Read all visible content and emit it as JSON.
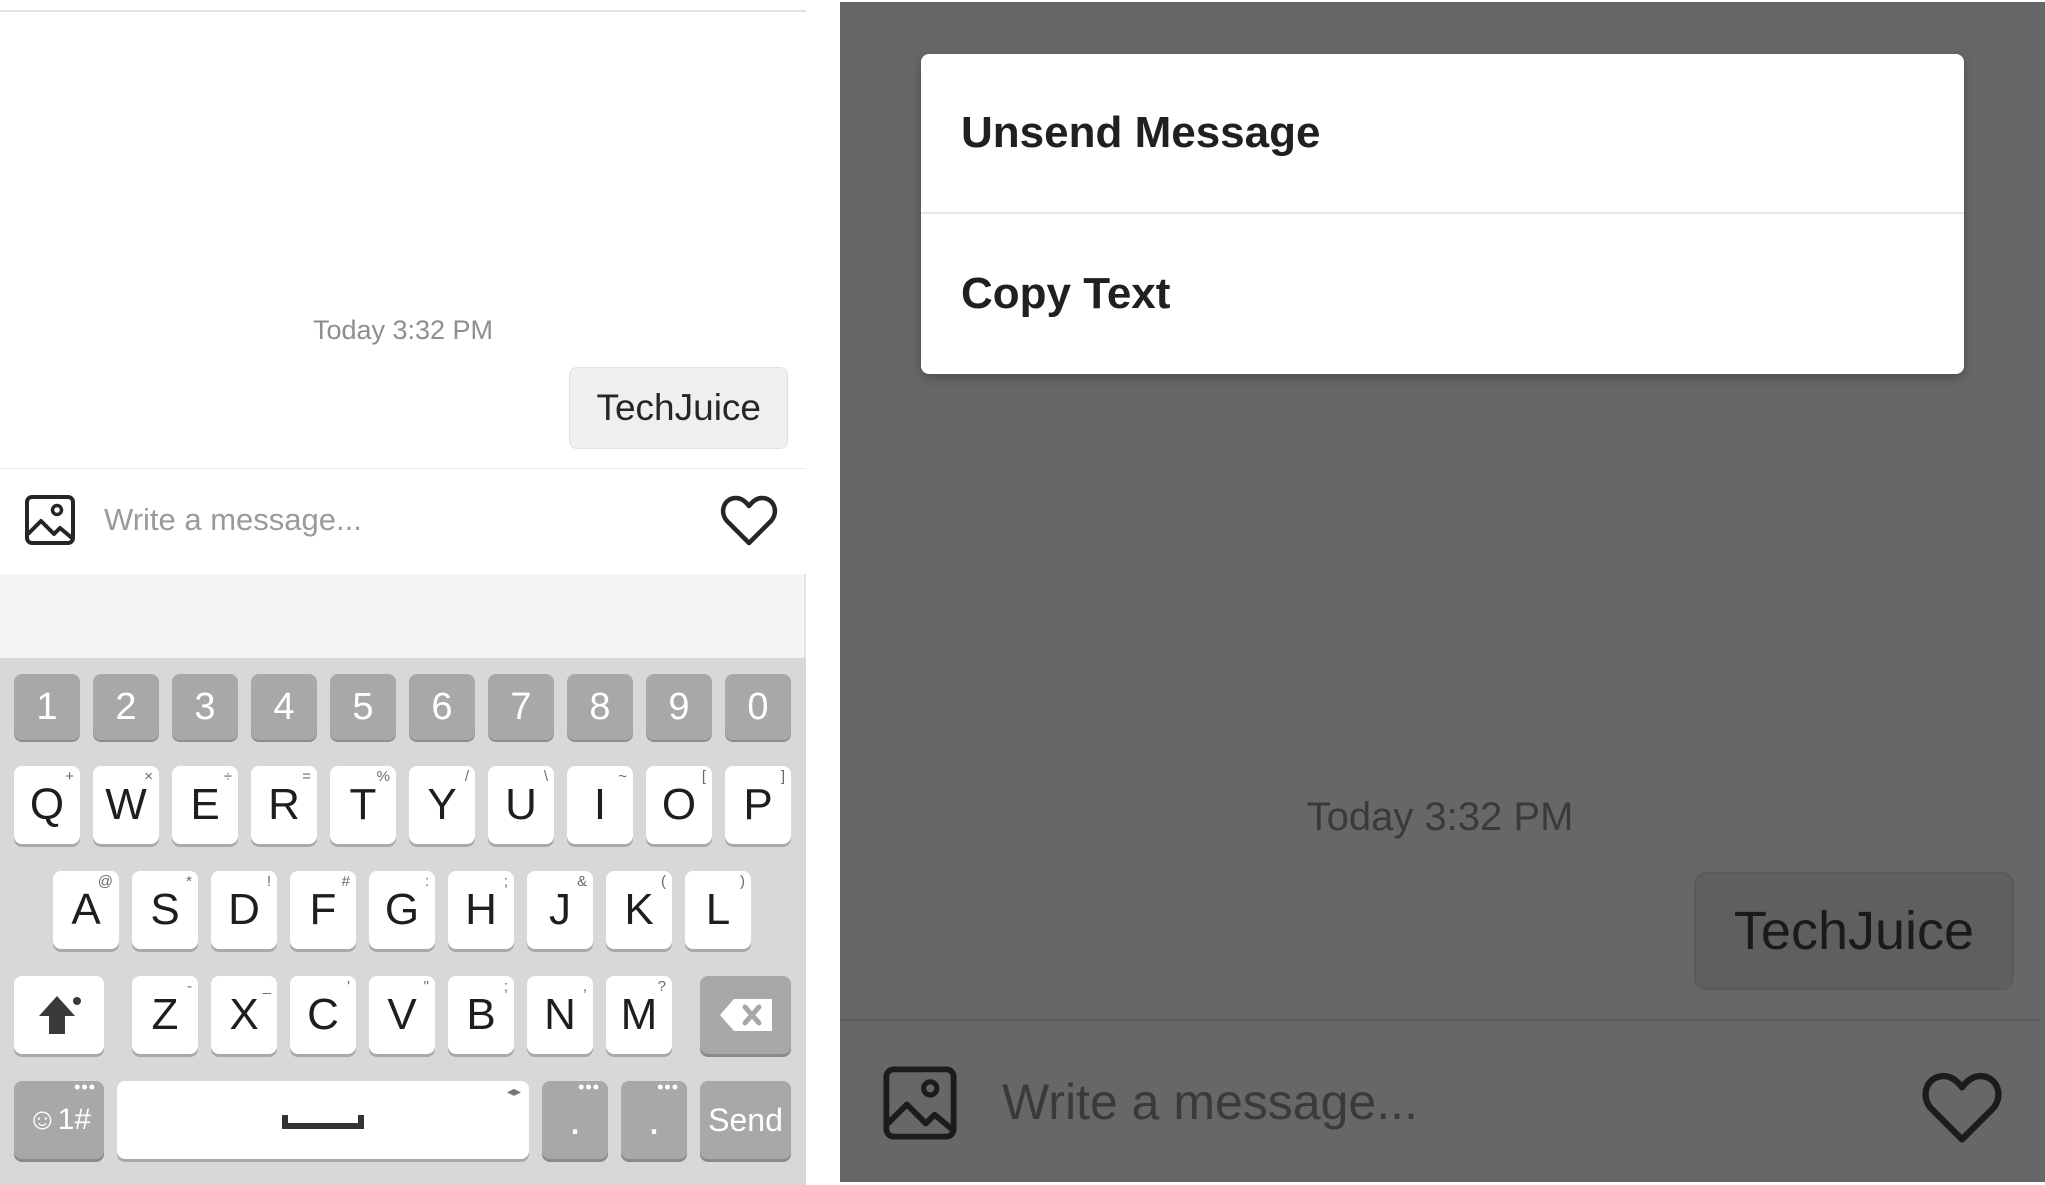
{
  "left_screen": {
    "timestamp": "Today 3:32 PM",
    "message_bubble": "TechJuice",
    "composer": {
      "placeholder": "Write a message...",
      "image_icon": "image-icon",
      "like_icon": "heart-icon"
    },
    "keyboard": {
      "number_row": [
        "1",
        "2",
        "3",
        "4",
        "5",
        "6",
        "7",
        "8",
        "9",
        "0"
      ],
      "row1": [
        {
          "label": "Q",
          "sub": "+"
        },
        {
          "label": "W",
          "sub": "×"
        },
        {
          "label": "E",
          "sub": "÷"
        },
        {
          "label": "R",
          "sub": "="
        },
        {
          "label": "T",
          "sub": "%"
        },
        {
          "label": "Y",
          "sub": "/"
        },
        {
          "label": "U",
          "sub": "\\"
        },
        {
          "label": "I",
          "sub": "~"
        },
        {
          "label": "O",
          "sub": "["
        },
        {
          "label": "P",
          "sub": "]"
        }
      ],
      "row2": [
        {
          "label": "A",
          "sub": "@"
        },
        {
          "label": "S",
          "sub": "*"
        },
        {
          "label": "D",
          "sub": "!"
        },
        {
          "label": "F",
          "sub": "#"
        },
        {
          "label": "G",
          "sub": ":"
        },
        {
          "label": "H",
          "sub": ";"
        },
        {
          "label": "J",
          "sub": "&"
        },
        {
          "label": "K",
          "sub": "("
        },
        {
          "label": "L",
          "sub": ")"
        }
      ],
      "row3": [
        {
          "label": "Z",
          "sub": "-"
        },
        {
          "label": "X",
          "sub": "_"
        },
        {
          "label": "C",
          "sub": "'"
        },
        {
          "label": "V",
          "sub": "\""
        },
        {
          "label": "B",
          "sub": ";"
        },
        {
          "label": "N",
          "sub": ","
        },
        {
          "label": "M",
          "sub": "?"
        }
      ],
      "shift_icon": "shift-arrow-icon",
      "backspace_icon": "backspace-icon",
      "symbols_label": "☺1#",
      "period_label_1": ".",
      "period_label_2": ".",
      "send_label": "Send"
    }
  },
  "right_screen": {
    "menu": {
      "items": [
        "Unsend Message",
        "Copy Text"
      ]
    },
    "timestamp": "Today 3:32 PM",
    "message_bubble": "TechJuice",
    "composer": {
      "placeholder": "Write a message...",
      "image_icon": "image-icon",
      "like_icon": "heart-icon"
    }
  },
  "colors": {
    "overlay": "#676767",
    "key_dark": "#a8a8a8",
    "keyboard_bg": "#d8d8d8",
    "bubble_bg": "#efefef"
  }
}
